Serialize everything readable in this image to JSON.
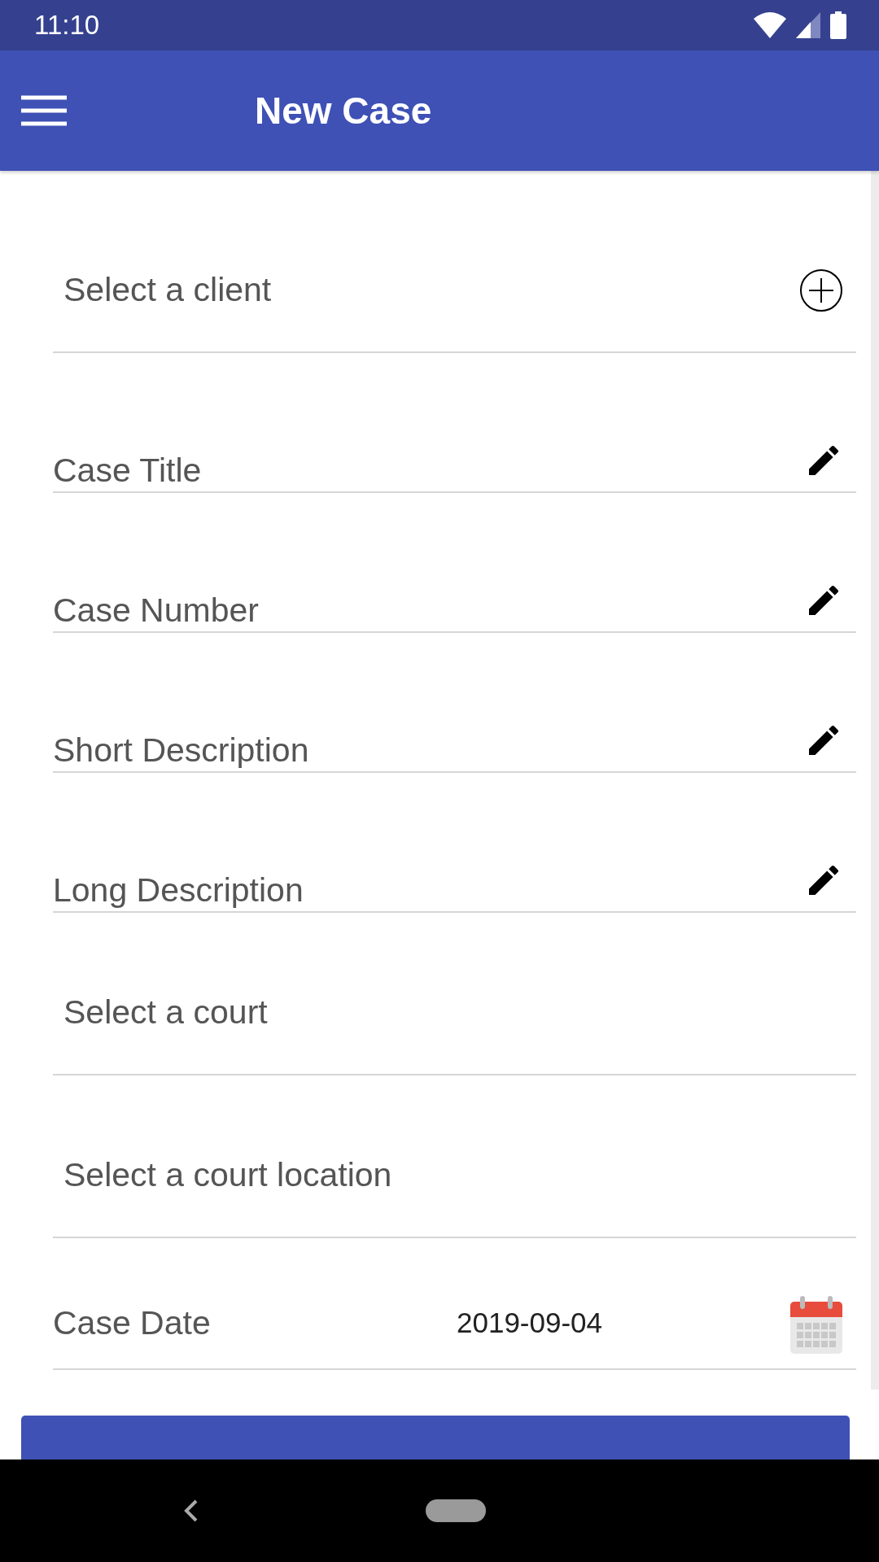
{
  "status_bar": {
    "time": "11:10"
  },
  "app_bar": {
    "title": "New Case"
  },
  "fields": [
    {
      "kind": "select-add",
      "placeholder": "Select a client"
    },
    {
      "kind": "text",
      "placeholder": "Case Title"
    },
    {
      "kind": "text",
      "placeholder": "Case Number"
    },
    {
      "kind": "text",
      "placeholder": "Short Description"
    },
    {
      "kind": "text",
      "placeholder": "Long Description"
    },
    {
      "kind": "select",
      "placeholder": "Select a court"
    },
    {
      "kind": "select",
      "placeholder": "Select a court location"
    },
    {
      "kind": "date",
      "label": "Case Date",
      "value": "2019-09-04"
    }
  ]
}
